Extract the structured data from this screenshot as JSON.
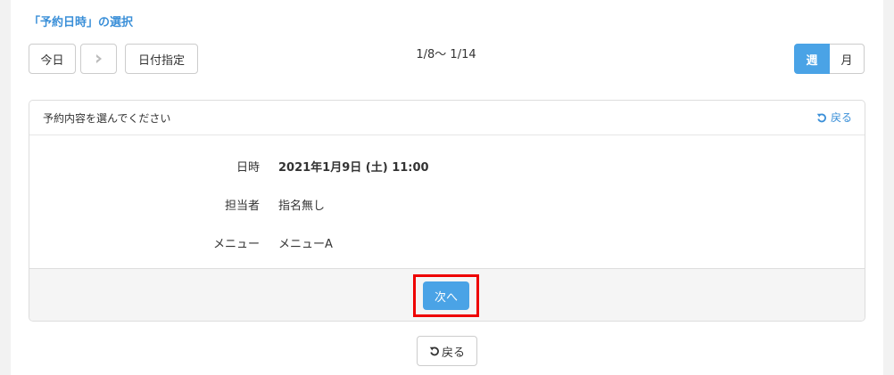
{
  "section": {
    "title": "「予約日時」の選択"
  },
  "nav": {
    "today_label": "今日",
    "next_icon": "chevron-right-icon",
    "date_select_label": "日付指定",
    "range_label": "1/8〜 1/14",
    "view_options": [
      {
        "label": "週",
        "active": true
      },
      {
        "label": "月",
        "active": false
      }
    ]
  },
  "card": {
    "header_title": "予約内容を選んでください",
    "back_label": "戻る",
    "back_icon": "undo-icon",
    "details": [
      {
        "label": "日時",
        "value": "2021年1月9日 (土) 11:00"
      },
      {
        "label": "担当者",
        "value": "指名無し"
      },
      {
        "label": "メニュー",
        "value": "メニューA"
      }
    ],
    "next_button_label": "次へ"
  },
  "footer": {
    "back_button_label": "戻る",
    "back_icon": "undo-icon"
  },
  "colors": {
    "accent": "#4aa3e6",
    "link": "#3a8fd8",
    "highlight": "#ee0000",
    "footer_bg": "#f5f5f5",
    "page_bg": "#f2f2f2"
  }
}
